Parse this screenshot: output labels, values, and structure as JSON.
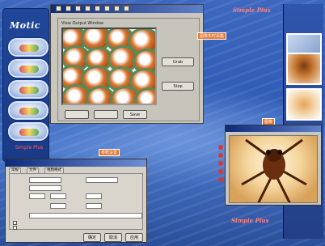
{
  "app": {
    "logo": "Motic"
  },
  "sidebar": {
    "caption": "Simple Plus"
  },
  "header_caption": "Simple Plus",
  "footer_brand": "Simple Plus",
  "window1": {
    "group_label": "View Output Window",
    "buttons": [
      "Grab",
      "Stop",
      "Save"
    ]
  },
  "window2": {
    "tabs": [
      "常规",
      "文件",
      "视频格式"
    ],
    "ok": "确定",
    "cancel": "取消",
    "apply": "应用"
  },
  "callouts": [
    "图像实时采集",
    "图像",
    "参数设置"
  ],
  "colors": {
    "accent": "#e8742b",
    "title_bar": "#0e2a7a"
  }
}
